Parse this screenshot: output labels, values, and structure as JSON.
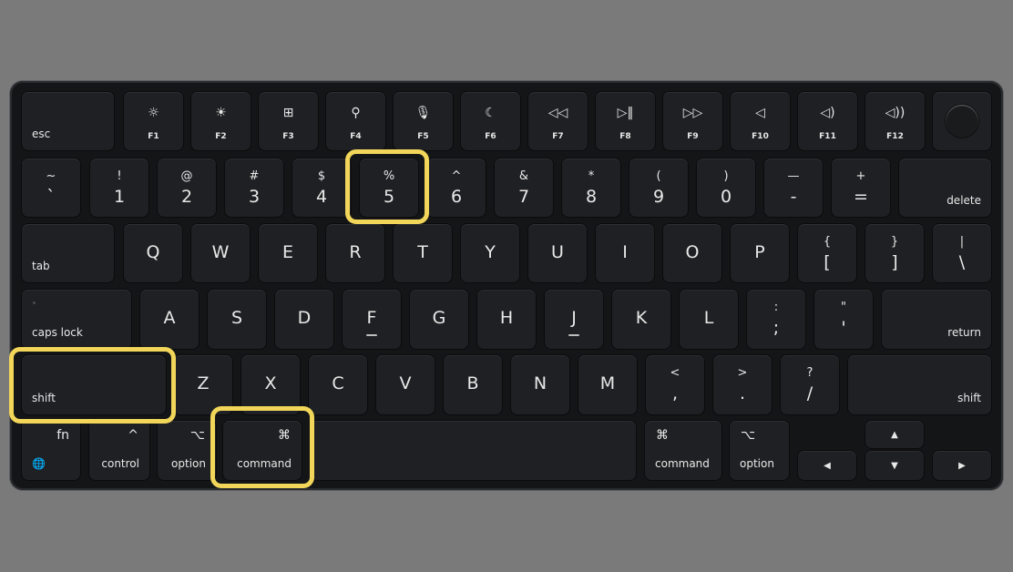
{
  "image_title": "Mac keyboard with Shift, Command and 5 keys highlighted",
  "highlight_color": "#f2d65a",
  "highlighted_keys": [
    "%5",
    "shift (left)",
    "command (left)"
  ],
  "function_row": [
    {
      "label": "esc",
      "icon": ""
    },
    {
      "label": "F1",
      "icon": "☼",
      "icon_name": "brightness-down-icon"
    },
    {
      "label": "F2",
      "icon": "☀",
      "icon_name": "brightness-up-icon"
    },
    {
      "label": "F3",
      "icon": "⊞",
      "icon_name": "mission-control-icon"
    },
    {
      "label": "F4",
      "icon": "⚲",
      "icon_name": "spotlight-search-icon"
    },
    {
      "label": "F5",
      "icon": "🎙",
      "icon_name": "dictation-mic-icon"
    },
    {
      "label": "F6",
      "icon": "☾",
      "icon_name": "do-not-disturb-moon-icon"
    },
    {
      "label": "F7",
      "icon": "◁◁",
      "icon_name": "rewind-icon"
    },
    {
      "label": "F8",
      "icon": "▷‖",
      "icon_name": "play-pause-icon"
    },
    {
      "label": "F9",
      "icon": "▷▷",
      "icon_name": "fast-forward-icon"
    },
    {
      "label": "F10",
      "icon": "◁",
      "icon_name": "mute-icon"
    },
    {
      "label": "F11",
      "icon": "◁)",
      "icon_name": "volume-down-icon"
    },
    {
      "label": "F12",
      "icon": "◁))",
      "icon_name": "volume-up-icon"
    }
  ],
  "number_row": [
    {
      "shifted": "~",
      "main": "`"
    },
    {
      "shifted": "!",
      "main": "1"
    },
    {
      "shifted": "@",
      "main": "2"
    },
    {
      "shifted": "#",
      "main": "3"
    },
    {
      "shifted": "$",
      "main": "4"
    },
    {
      "shifted": "%",
      "main": "5"
    },
    {
      "shifted": "^",
      "main": "6"
    },
    {
      "shifted": "&",
      "main": "7"
    },
    {
      "shifted": "*",
      "main": "8"
    },
    {
      "shifted": "(",
      "main": "9"
    },
    {
      "shifted": ")",
      "main": "0"
    },
    {
      "shifted": "—",
      "main": "-"
    },
    {
      "shifted": "+",
      "main": "="
    }
  ],
  "delete_label": "delete",
  "tab_label": "tab",
  "qwerty_row": [
    "Q",
    "W",
    "E",
    "R",
    "T",
    "Y",
    "U",
    "I",
    "O",
    "P"
  ],
  "bracket_keys": [
    {
      "shifted": "{",
      "main": "["
    },
    {
      "shifted": "}",
      "main": "]"
    },
    {
      "shifted": "|",
      "main": "\\"
    }
  ],
  "caps_lock_label": "caps lock",
  "home_row": [
    "A",
    "S",
    "D",
    "F",
    "G",
    "H",
    "J",
    "K",
    "L"
  ],
  "home_punct": [
    {
      "shifted": ":",
      "main": ";"
    },
    {
      "shifted": "\"",
      "main": "'"
    }
  ],
  "return_label": "return",
  "shift_label": "shift",
  "bottom_letters": [
    "Z",
    "X",
    "C",
    "V",
    "B",
    "N",
    "M"
  ],
  "bottom_punct": [
    {
      "shifted": "<",
      "main": ","
    },
    {
      "shifted": ">",
      "main": "."
    },
    {
      "shifted": "?",
      "main": "/"
    }
  ],
  "modifiers": {
    "fn": "fn",
    "globe": "🌐",
    "control": "control",
    "control_symbol": "^",
    "option": "option",
    "option_symbol": "⌥",
    "command": "command",
    "command_symbol": "⌘"
  },
  "arrows": {
    "up": "▲",
    "down": "▼",
    "left": "◀",
    "right": "▶"
  }
}
